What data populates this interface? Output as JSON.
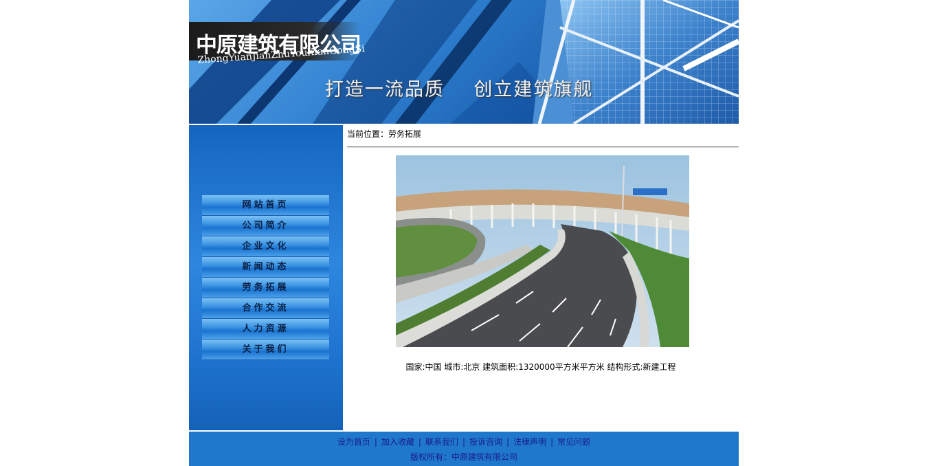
{
  "banner": {
    "company_name": "中原建筑有限公司",
    "company_pinyin": "ZhongYuanJianZhuYouXianGongSi",
    "slogan": "打造一流品质    创立建筑旗舰"
  },
  "sidebar": {
    "items": [
      {
        "label": "网站首页"
      },
      {
        "label": "公司简介"
      },
      {
        "label": "企业文化"
      },
      {
        "label": "新闻动态"
      },
      {
        "label": "劳务拓展"
      },
      {
        "label": "合作交流"
      },
      {
        "label": "人力资源"
      },
      {
        "label": "关于我们"
      }
    ]
  },
  "main": {
    "breadcrumb": "当前位置：劳务拓展",
    "caption": "国家:中国 城市:北京 建筑面积:1320000平方米平方米 结构形式:新建工程"
  },
  "footer": {
    "links": [
      {
        "label": "设为首页"
      },
      {
        "label": "加入收藏"
      },
      {
        "label": "联系我们"
      },
      {
        "label": "投诉咨询"
      },
      {
        "label": "法律声明"
      },
      {
        "label": "常见问题"
      }
    ],
    "separator": "|",
    "copyright": "版权所有：中原建筑有限公司"
  },
  "colors": {
    "footer_bg": "#1f78cc",
    "sidebar_bg": "#2e86de",
    "link": "#1a1a8a"
  }
}
